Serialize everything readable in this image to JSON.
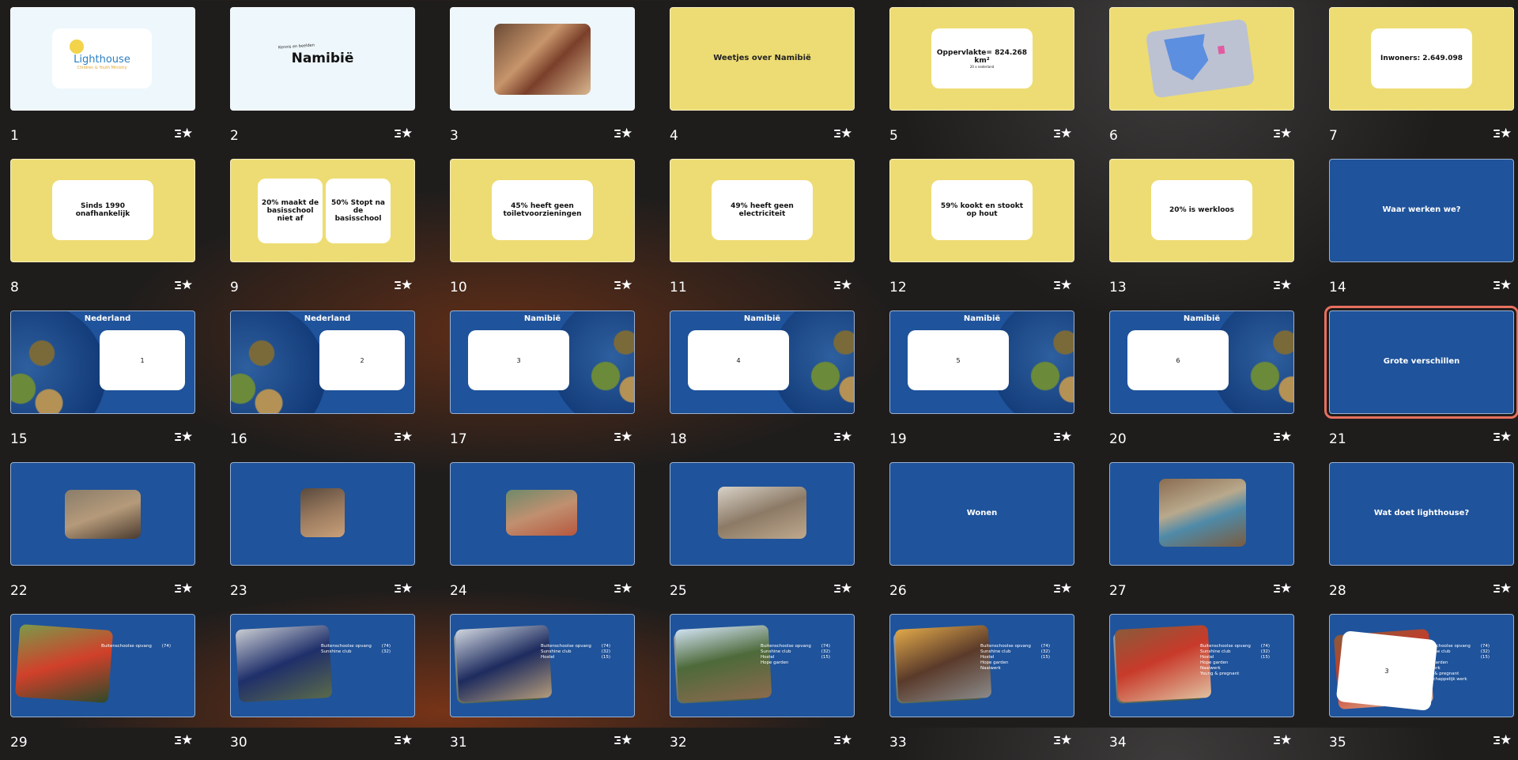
{
  "colors": {
    "yellow": "#eddc73",
    "blue": "#1f539b",
    "light": "#eef7fc",
    "selection": "#e8705f"
  },
  "star_icon": "star-lines-icon",
  "slides": [
    {
      "n": "1",
      "logo_text": "Lighthouse",
      "logo_sub": "Children & Youth Ministry"
    },
    {
      "n": "2",
      "subtitle": "Kennis en beelden",
      "title": "Namibië"
    },
    {
      "n": "3"
    },
    {
      "n": "4",
      "title": "Weetjes over Namibië"
    },
    {
      "n": "5",
      "title": "Oppervlakte= 824.268 km²",
      "small": "20 x nederland"
    },
    {
      "n": "6"
    },
    {
      "n": "7",
      "title": "Inwoners: 2.649.098"
    },
    {
      "n": "8",
      "title": "Sinds 1990 onafhankelijk"
    },
    {
      "n": "9",
      "left": "20% maakt de basisschool niet af",
      "right": "50% Stopt na de basisschool"
    },
    {
      "n": "10",
      "title": "45% heeft geen toiletvoorzieningen"
    },
    {
      "n": "11",
      "title": "49% heeft geen electriciteit"
    },
    {
      "n": "12",
      "title": "59% kookt en stookt op hout"
    },
    {
      "n": "13",
      "title": "20% is werkloos"
    },
    {
      "n": "14",
      "title": "Waar werken we?"
    },
    {
      "n": "15",
      "heading": "Nederland",
      "card": "1"
    },
    {
      "n": "16",
      "heading": "Nederland",
      "card": "2"
    },
    {
      "n": "17",
      "heading": "Namibië",
      "card": "3"
    },
    {
      "n": "18",
      "heading": "Namibië",
      "card": "4"
    },
    {
      "n": "19",
      "heading": "Namibië",
      "card": "5"
    },
    {
      "n": "20",
      "heading": "Namibië",
      "card": "6"
    },
    {
      "n": "21",
      "title": "Grote verschillen"
    },
    {
      "n": "22"
    },
    {
      "n": "23"
    },
    {
      "n": "24"
    },
    {
      "n": "25"
    },
    {
      "n": "26",
      "title": "Wonen"
    },
    {
      "n": "27"
    },
    {
      "n": "28",
      "title": "Wat doet lighthouse?"
    },
    {
      "n": "29"
    },
    {
      "n": "30"
    },
    {
      "n": "31"
    },
    {
      "n": "32"
    },
    {
      "n": "33"
    },
    {
      "n": "34"
    },
    {
      "n": "35",
      "card": "3"
    }
  ],
  "programs": [
    {
      "name": "Buitenschoolse opvang",
      "count": "(74)"
    },
    {
      "name": "Sunshine club",
      "count": "(32)"
    },
    {
      "name": "Hostel",
      "count": "(15)"
    },
    {
      "name": "Hope garden",
      "count": ""
    },
    {
      "name": "Naaiwerk",
      "count": ""
    },
    {
      "name": "Young & pregnant",
      "count": ""
    },
    {
      "name": "Maatschappelijk werk",
      "count": ""
    }
  ]
}
